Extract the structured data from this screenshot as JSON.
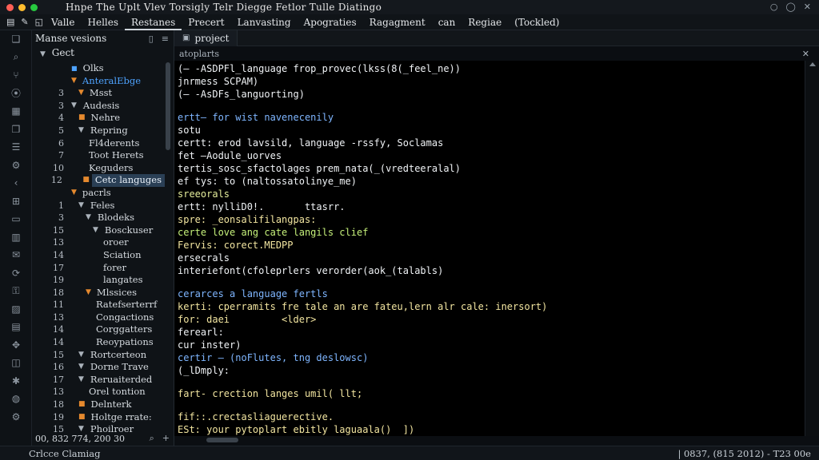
{
  "window": {
    "title": "Hnpe The Uplt Vlev Torsigly Telr Diegge Fetlor Tulle Diatingo",
    "controls": [
      "○",
      "◯",
      "✕"
    ]
  },
  "menu": {
    "items": [
      "Valle",
      "Helles",
      "Restanes",
      "Precert",
      "Lanvasting",
      "Apograties",
      "Ragagment",
      "can",
      "Regiae",
      "(Tockled)"
    ]
  },
  "colors": {
    "orange": "#e5892e",
    "blue": "#4ea3ff",
    "selection": "#2a3f55"
  },
  "sidebar": {
    "title": "Manse vesions",
    "root": "Gect",
    "footer_left": "00, 832 774, 200 30",
    "footer_icons": [
      "search-icon",
      "plus-icon"
    ],
    "tree": [
      {
        "num": "",
        "label": "Olks",
        "marker": "blue-square",
        "indent": 1
      },
      {
        "num": "",
        "label": "AnteralEbge",
        "marker": "orange-caret",
        "indent": 1,
        "accent": "blue"
      },
      {
        "num": "3",
        "label": "Msst",
        "marker": "orange-caret",
        "indent": 2
      },
      {
        "num": "3",
        "label": "Audesis",
        "marker": "caret",
        "indent": 1
      },
      {
        "num": "4",
        "label": "Nehre",
        "marker": "orange",
        "indent": 2
      },
      {
        "num": "5",
        "label": "Repring",
        "marker": "caret",
        "indent": 2
      },
      {
        "num": "6",
        "label": "Fl4derents",
        "marker": "",
        "indent": 3
      },
      {
        "num": "7",
        "label": "Toot Herets",
        "marker": "",
        "indent": 3
      },
      {
        "num": "10",
        "label": "Keguders",
        "marker": "",
        "indent": 3
      },
      {
        "num": "12",
        "label": "Cetc languges",
        "marker": "orange",
        "indent": 3,
        "selected": true
      },
      {
        "num": "",
        "label": "pacrls",
        "marker": "orange-caret",
        "indent": 1
      },
      {
        "num": "1",
        "label": "Feles",
        "marker": "caret",
        "indent": 2
      },
      {
        "num": "3",
        "label": "Blodeks",
        "marker": "caret",
        "indent": 3
      },
      {
        "num": "15",
        "label": "Bosckuser",
        "marker": "caret",
        "indent": 4
      },
      {
        "num": "13",
        "label": "oroer",
        "marker": "",
        "indent": 5
      },
      {
        "num": "14",
        "label": "Sciation",
        "marker": "",
        "indent": 5
      },
      {
        "num": "17",
        "label": "forer",
        "marker": "",
        "indent": 5
      },
      {
        "num": "19",
        "label": "langates",
        "marker": "",
        "indent": 5
      },
      {
        "num": "18",
        "label": "Mlssices",
        "marker": "orange-caret",
        "indent": 3
      },
      {
        "num": "11",
        "label": "Ratefserterrf",
        "marker": "",
        "indent": 4
      },
      {
        "num": "13",
        "label": "Congactions",
        "marker": "",
        "indent": 4
      },
      {
        "num": "14",
        "label": "Corggatters",
        "marker": "",
        "indent": 4
      },
      {
        "num": "14",
        "label": "Reoypations",
        "marker": "",
        "indent": 4
      },
      {
        "num": "15",
        "label": "Rortcerteon",
        "marker": "caret",
        "indent": 2
      },
      {
        "num": "16",
        "label": "Dorne Trave",
        "marker": "caret",
        "indent": 2
      },
      {
        "num": "17",
        "label": "Reruaiterded",
        "marker": "caret",
        "indent": 2
      },
      {
        "num": "13",
        "label": "Orel tontion",
        "marker": "",
        "indent": 3
      },
      {
        "num": "18",
        "label": "Delnterk",
        "marker": "orange",
        "indent": 2
      },
      {
        "num": "19",
        "label": "Holtge rrate:",
        "marker": "orange",
        "indent": 2
      },
      {
        "num": "15",
        "label": "Phoilroer",
        "marker": "caret",
        "indent": 2
      }
    ]
  },
  "activity_icons": [
    "files-icon",
    "search-icon",
    "source-control-icon",
    "debug-icon",
    "extensions-icon",
    "book-icon",
    "list-icon",
    "settings-icon",
    "chevron-left-icon",
    "grid-icon",
    "terminal-icon",
    "layout-icon",
    "chat-icon",
    "refresh-icon",
    "lock-icon",
    "image-icon",
    "chart-icon",
    "puzzle-icon",
    "window-icon",
    "bug-icon",
    "globe-icon",
    "gear-icon"
  ],
  "editor": {
    "tab_label": "project",
    "breadcrumb": "atoplarts",
    "breadcrumb_right": "✕",
    "lines": [
      {
        "text": "(— -ASDPFl_language frop_provec(lkss(8(_feel_ne))",
        "color": "#f0f3f6"
      },
      {
        "text": "jnrmess SCPAM)",
        "color": "#f0f3f6"
      },
      {
        "text": "(— -AsDFs_languorting)",
        "color": "#f0f3f6"
      },
      {
        "text": "",
        "blank": true
      },
      {
        "text": "ertt— for wist navenecenily",
        "color": "#7fb6ff"
      },
      {
        "text": "sotu",
        "color": "#f0f3f6"
      },
      {
        "text": "certt: erod lavsild, language -rssfy, Soclamas",
        "color": "#f0f3f6"
      },
      {
        "text": "fet —Aodule_uorves",
        "color": "#f0f3f6"
      },
      {
        "text": "tertis_sosc_sfactolages prem_nata(_(vredteeralal)",
        "color": "#f0f3f6"
      },
      {
        "text": "ef tys: to (naltossatolinye_me)",
        "color": "#f0f3f6"
      },
      {
        "text": "sreeorals",
        "color": "#e6ee9c"
      },
      {
        "text": "ertt: nylliD0!.       ttasrr.",
        "color": "#f0f3f6"
      },
      {
        "text": "spre: _eonsalifilangpas:",
        "color": "#f2e5a0"
      },
      {
        "text": "certe love ang cate langils clief",
        "color": "#c5f07a"
      },
      {
        "text": "Fervis: corect.MEDPP",
        "color": "#f2e5a0"
      },
      {
        "text": "ersecrals",
        "color": "#f0f3f6"
      },
      {
        "text": "interiefont(cfoleprlers verorder(aok_(talabls)",
        "color": "#f0f3f6"
      },
      {
        "text": "",
        "blank": true
      },
      {
        "text": "cerarces a language fertls",
        "color": "#7fb6ff"
      },
      {
        "text": "kerti: cperramits fre tale an are fateu,lern alr cale: inersort)",
        "color": "#f2e5a0"
      },
      {
        "text": "for: daei         <lder>",
        "color": "#f2e5a0"
      },
      {
        "text": "ferearl:",
        "color": "#f0f3f6"
      },
      {
        "text": "cur inster)",
        "color": "#f0f3f6"
      },
      {
        "text": "certir — (noFlutes, tng deslowsc)",
        "color": "#7fb6ff"
      },
      {
        "text": "(_lDmply:",
        "color": "#f0f3f6"
      },
      {
        "text": "",
        "blank": true
      },
      {
        "text": "fart- crection langes umil( llt;",
        "color": "#f2e5a0"
      },
      {
        "text": "",
        "blank": true
      },
      {
        "text": "fif::.crectasliaguerective.",
        "color": "#f2e5a0"
      },
      {
        "text": "ESt: your pytoplart ebitly laguaala()  ])",
        "color": "#f2e5a0"
      }
    ]
  },
  "status": {
    "left": "Crlcce Clamiag",
    "right": "| 0837, (815 2012) - T23 00e"
  }
}
